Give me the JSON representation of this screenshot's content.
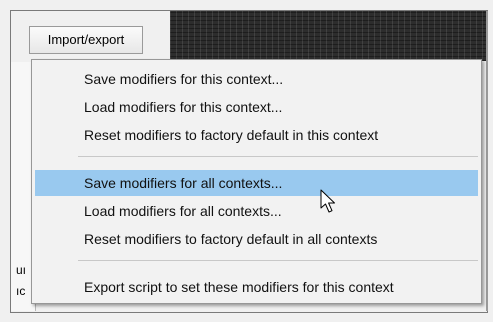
{
  "toolbar": {
    "import_export_label": "Import/export"
  },
  "left_panel": {
    "frag1": "uı",
    "frag2": "ıc"
  },
  "menu": {
    "items": [
      {
        "label": "Save modifiers for this context..."
      },
      {
        "label": "Load modifiers for this context..."
      },
      {
        "label": "Reset modifiers to factory default in this context"
      },
      {
        "label": "Save modifiers for all contexts...",
        "highlighted": true
      },
      {
        "label": "Load modifiers for all contexts..."
      },
      {
        "label": "Reset modifiers to factory default in all contexts"
      },
      {
        "label": "Export script to set these modifiers for this context"
      }
    ]
  },
  "colors": {
    "highlight": "#99c9ef",
    "menu_bg": "#f2f2f2",
    "dark_strip": "#2d2d2d"
  },
  "cursor": {
    "icon": "pointer-arrow-icon"
  }
}
